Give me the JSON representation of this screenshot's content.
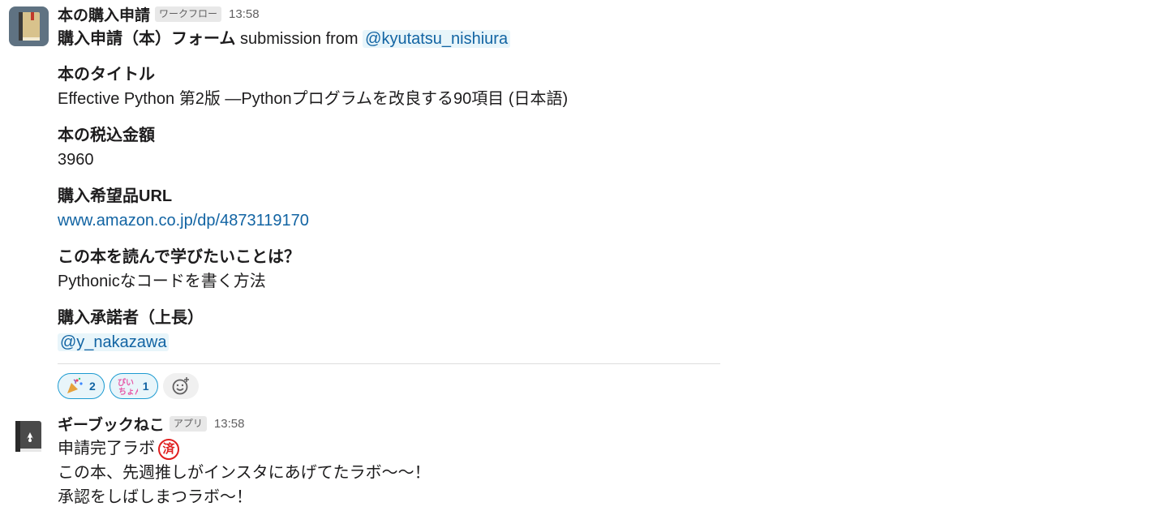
{
  "message1": {
    "sender": "本の購入申請",
    "badge": "ワークフロー",
    "time": "13:58",
    "form_title": "購入申請（本）フォーム",
    "submission_text": "submission from",
    "submitter_mention": "@kyutatsu_nishiura",
    "fields": [
      {
        "label": "本のタイトル",
        "value": "Effective Python 第2版 ―Pythonプログラムを改良する90項目 (日本語)"
      },
      {
        "label": "本の税込金額",
        "value": "3960"
      },
      {
        "label": "購入希望品URL",
        "value": "www.amazon.co.jp/dp/4873119170"
      },
      {
        "label": "この本を読んで学びたいことは？",
        "value": "Pythonicなコードを書く方法"
      },
      {
        "label": "購入承諾者（上長）",
        "value": "@y_nakazawa"
      }
    ],
    "reactions": [
      {
        "icon": "party-popper-icon",
        "count": "2"
      },
      {
        "icon": "piyun-text-icon",
        "count": "1"
      }
    ]
  },
  "message2": {
    "sender": "ギーブックねこ",
    "badge": "アプリ",
    "time": "13:58",
    "lines": [
      "申請完了ラボ",
      "この本、先週推しがインスタにあげてたラボ〜〜！",
      "承認をしばしまつラボ〜！"
    ],
    "stamp_text": "済"
  },
  "colors": {
    "link": "#1264a3",
    "mention_bg": "#e8f5fa",
    "reaction_border": "#1d9bd1",
    "stamp": "#e01e1e"
  }
}
